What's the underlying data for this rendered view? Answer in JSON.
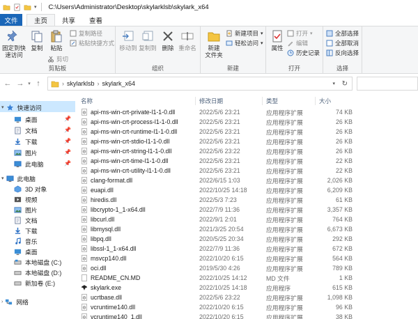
{
  "title_bar": {
    "path": "C:\\Users\\Administrator\\Desktop\\skylarklsb\\skylark_x64"
  },
  "tabs": [
    "文件",
    "主页",
    "共享",
    "查看"
  ],
  "ribbon": {
    "clipboard": {
      "pin_label": "固定到快\n速访问",
      "copy_label": "复制",
      "paste_label": "粘贴",
      "copy_path": "复制路径",
      "paste_shortcut": "粘贴快捷方式",
      "cut": "剪切",
      "group": "剪贴板"
    },
    "organize": {
      "move_to": "移动到",
      "copy_to": "复制到",
      "delete": "删除",
      "rename": "重命名",
      "group": "组织"
    },
    "new": {
      "new_folder": "新建\n文件夹",
      "new_item": "新建项目",
      "easy_access": "轻松访问",
      "group": "新建"
    },
    "open": {
      "properties": "属性",
      "open": "打开",
      "edit": "编辑",
      "history": "历史记录",
      "group": "打开"
    },
    "select": {
      "select_all": "全部选择",
      "select_none": "全部取消",
      "invert": "反向选择",
      "group": "选择"
    }
  },
  "address": {
    "crumbs": [
      "skylarklsb",
      "skylark_x64"
    ]
  },
  "sidebar": {
    "quick_access": "快速访问",
    "quick_items": [
      "桌面",
      "文档",
      "下载",
      "图片",
      "此电脑"
    ],
    "this_pc": "此电脑",
    "pc_items": [
      "3D 对象",
      "视频",
      "图片",
      "文档",
      "下载",
      "音乐",
      "桌面",
      "本地磁盘 (C:)",
      "本地磁盘 (D:)",
      "新加卷 (E:)"
    ],
    "network": "网络"
  },
  "columns": {
    "name": "名称",
    "date": "修改日期",
    "type": "类型",
    "size": "大小"
  },
  "files": [
    {
      "name": "api-ms-win-crt-private-l1-1-0.dll",
      "date": "2022/5/6 23:21",
      "type": "应用程序扩展",
      "size": "74 KB"
    },
    {
      "name": "api-ms-win-crt-process-l1-1-0.dll",
      "date": "2022/5/6 23:21",
      "type": "应用程序扩展",
      "size": "26 KB"
    },
    {
      "name": "api-ms-win-crt-runtime-l1-1-0.dll",
      "date": "2022/5/6 23:21",
      "type": "应用程序扩展",
      "size": "26 KB"
    },
    {
      "name": "api-ms-win-crt-stdio-l1-1-0.dll",
      "date": "2022/5/6 23:21",
      "type": "应用程序扩展",
      "size": "26 KB"
    },
    {
      "name": "api-ms-win-crt-string-l1-1-0.dll",
      "date": "2022/5/6 23:22",
      "type": "应用程序扩展",
      "size": "26 KB"
    },
    {
      "name": "api-ms-win-crt-time-l1-1-0.dll",
      "date": "2022/5/6 23:21",
      "type": "应用程序扩展",
      "size": "22 KB"
    },
    {
      "name": "api-ms-win-crt-utility-l1-1-0.dll",
      "date": "2022/5/6 23:21",
      "type": "应用程序扩展",
      "size": "22 KB"
    },
    {
      "name": "clang-format.dll",
      "date": "2022/6/15 1:03",
      "type": "应用程序扩展",
      "size": "2,026 KB"
    },
    {
      "name": "euapi.dll",
      "date": "2022/10/25 14:18",
      "type": "应用程序扩展",
      "size": "6,209 KB"
    },
    {
      "name": "hiredis.dll",
      "date": "2022/5/3 7:23",
      "type": "应用程序扩展",
      "size": "61 KB"
    },
    {
      "name": "libcrypto-1_1-x64.dll",
      "date": "2022/7/9 11:36",
      "type": "应用程序扩展",
      "size": "3,357 KB"
    },
    {
      "name": "libcurl.dll",
      "date": "2022/9/1 2:01",
      "type": "应用程序扩展",
      "size": "764 KB"
    },
    {
      "name": "libmysql.dll",
      "date": "2021/3/25 20:54",
      "type": "应用程序扩展",
      "size": "6,673 KB"
    },
    {
      "name": "libpq.dll",
      "date": "2020/5/25 20:34",
      "type": "应用程序扩展",
      "size": "292 KB"
    },
    {
      "name": "libssl-1_1-x64.dll",
      "date": "2022/7/9 11:36",
      "type": "应用程序扩展",
      "size": "672 KB"
    },
    {
      "name": "msvcp140.dll",
      "date": "2022/10/20 6:15",
      "type": "应用程序扩展",
      "size": "564 KB"
    },
    {
      "name": "oci.dll",
      "date": "2019/5/30 4:26",
      "type": "应用程序扩展",
      "size": "789 KB"
    },
    {
      "name": "README_CN.MD",
      "date": "2022/10/25 14:12",
      "type": "MD 文件",
      "size": "1 KB"
    },
    {
      "name": "skylark.exe",
      "date": "2022/10/25 14:18",
      "type": "应用程序",
      "size": "615 KB"
    },
    {
      "name": "ucrtbase.dll",
      "date": "2022/5/6 23:22",
      "type": "应用程序扩展",
      "size": "1,098 KB"
    },
    {
      "name": "vcruntime140.dll",
      "date": "2022/10/20 6:15",
      "type": "应用程序扩展",
      "size": "96 KB"
    },
    {
      "name": "vcruntime140_1.dll",
      "date": "2022/10/20 6:15",
      "type": "应用程序扩展",
      "size": "38 KB"
    }
  ]
}
